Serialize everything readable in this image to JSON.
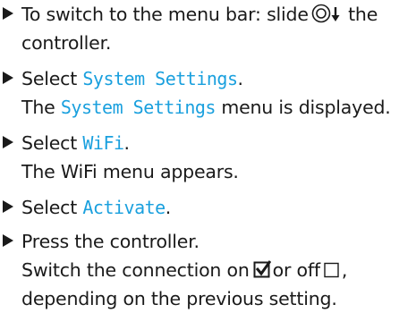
{
  "steps": [
    {
      "line1_pre": "To switch to the menu bar: slide",
      "line1_post": "the",
      "line2": "controller.",
      "icon": "controller-slide-down-icon"
    },
    {
      "line1_pre": "Select",
      "term": "System Settings",
      "line1_post": ".",
      "line2_pre": "The",
      "line2_term": "System Settings",
      "line2_post": "menu is displayed."
    },
    {
      "line1_pre": "Select",
      "term": "WiFi",
      "line1_post": ".",
      "line2": "The WiFi menu appears."
    },
    {
      "line1_pre": "Select",
      "term": "Activate",
      "line1_post": "."
    },
    {
      "line1": "Press the controller.",
      "line2_pre": "Switch the connection on",
      "line2_mid": "or off",
      "line2_post": ",",
      "line3": "depending on the previous setting.",
      "icons": [
        "checked-box-icon",
        "empty-box-icon"
      ]
    }
  ],
  "colors": {
    "text": "#1a1a1a",
    "menu_term": "#1aa0de"
  }
}
